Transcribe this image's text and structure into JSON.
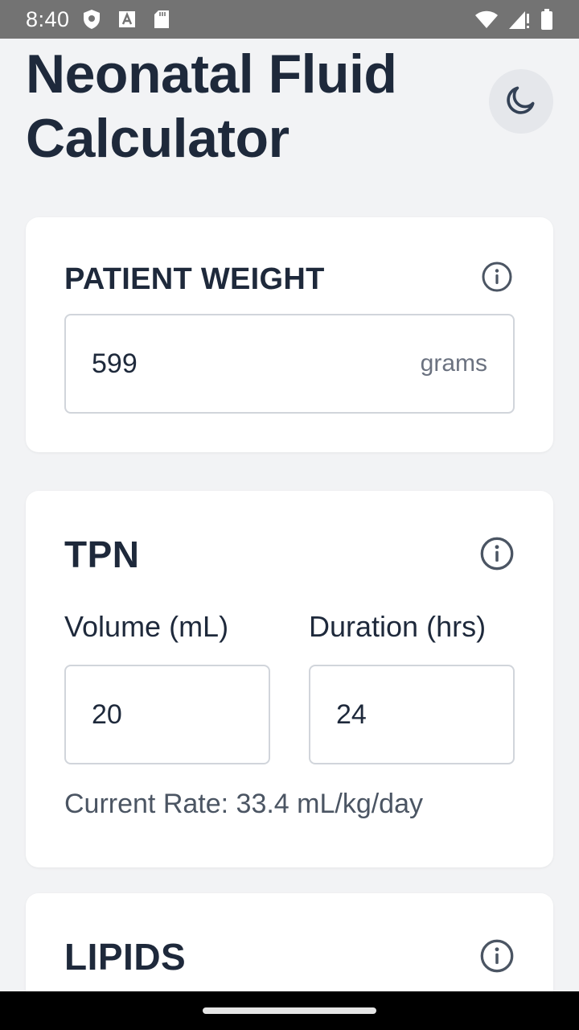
{
  "status_bar": {
    "time": "8:40",
    "left_icons": [
      "shield-icon",
      "font-a-icon",
      "sd-card-icon"
    ],
    "right_icons": [
      "wifi-icon",
      "cell-signal-alert-icon",
      "battery-icon"
    ]
  },
  "header": {
    "title": "Neonatal Fluid Calculator",
    "theme_toggle_icon": "moon-icon"
  },
  "patient_weight": {
    "title": "PATIENT WEIGHT",
    "value": "599",
    "unit": "grams",
    "info_icon": "info-icon"
  },
  "tpn": {
    "title": "TPN",
    "volume_label": "Volume (mL)",
    "volume_value": "20",
    "duration_label": "Duration (hrs)",
    "duration_value": "24",
    "rate_text": "Current Rate: 33.4 mL/kg/day",
    "info_icon": "info-icon"
  },
  "lipids": {
    "title": "LIPIDS",
    "info_icon": "info-icon"
  },
  "colors": {
    "background": "#f2f3f5",
    "card": "#ffffff",
    "text_primary": "#1e293b",
    "text_secondary": "#4b5563",
    "status_bar": "#737373",
    "border": "#d1d5db"
  }
}
